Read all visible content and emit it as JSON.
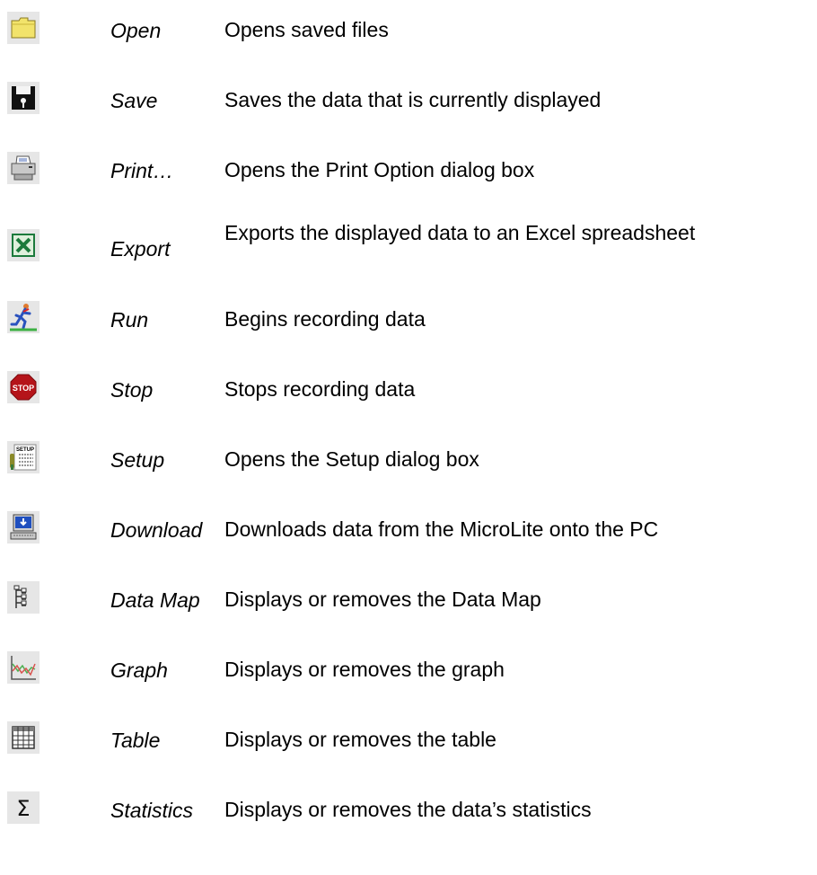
{
  "toolbar_buttons": [
    {
      "icon": "folder-icon",
      "name": "Open",
      "description": "Opens saved files"
    },
    {
      "icon": "floppy-disk-icon",
      "name": "Save",
      "description": "Saves the data that is currently displayed"
    },
    {
      "icon": "printer-icon",
      "name": "Print…",
      "description": "Opens the Print Option dialog box"
    },
    {
      "icon": "excel-icon",
      "name": "Export",
      "description": "Exports the displayed data to an Excel spreadsheet"
    },
    {
      "icon": "running-man-icon",
      "name": "Run",
      "description": "Begins recording data"
    },
    {
      "icon": "stop-sign-icon",
      "name": "Stop",
      "description": "Stops recording data",
      "icon_text": "STOP"
    },
    {
      "icon": "setup-icon",
      "name": "Setup",
      "description": "Opens the Setup dialog box",
      "icon_text": "SETUP"
    },
    {
      "icon": "computer-download-icon",
      "name": "Download",
      "description": "Downloads data from the MicroLite onto the PC"
    },
    {
      "icon": "tree-map-icon",
      "name": "Data Map",
      "description": "Displays or removes the Data Map"
    },
    {
      "icon": "graph-icon",
      "name": "Graph",
      "description": "Displays or removes the graph"
    },
    {
      "icon": "table-grid-icon",
      "name": "Table",
      "description": "Displays or removes the table"
    },
    {
      "icon": "sigma-icon",
      "name": "Statistics",
      "description": "Displays or removes the data’s statistics",
      "icon_text": "Σ"
    }
  ],
  "colors": {
    "folder": "#f2e36b",
    "excel_green": "#1c7a3c",
    "stop_red": "#b5141a",
    "graph_green": "#4caf50",
    "graph_red": "#d9534f"
  }
}
